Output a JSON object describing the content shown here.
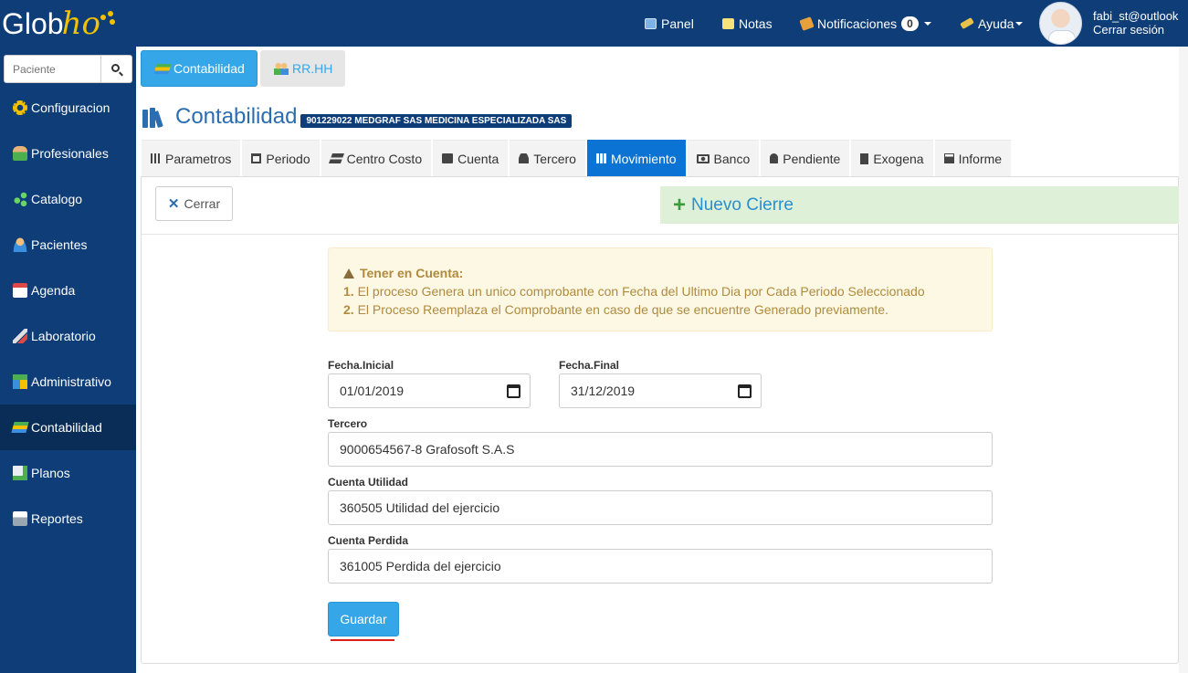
{
  "brand": {
    "logo_prefix": "Glob",
    "logo_script": "ho"
  },
  "topnav": {
    "panel": "Panel",
    "notas": "Notas",
    "notificaciones": "Notificaciones",
    "notif_count": "0",
    "ayuda": "Ayuda",
    "user_email": "fabi_st@outlook",
    "logout": "Cerrar sesión"
  },
  "sidebar": {
    "search_placeholder": "Paciente",
    "items": [
      {
        "label": "Configuracion",
        "icon": "gear-icon"
      },
      {
        "label": "Profesionales",
        "icon": "professionals-icon"
      },
      {
        "label": "Catalogo",
        "icon": "catalog-icon"
      },
      {
        "label": "Pacientes",
        "icon": "patient-icon"
      },
      {
        "label": "Agenda",
        "icon": "calendar-icon"
      },
      {
        "label": "Laboratorio",
        "icon": "laboratory-icon"
      },
      {
        "label": "Administrativo",
        "icon": "administrative-icon"
      },
      {
        "label": "Contabilidad",
        "icon": "accounting-icon",
        "active": true
      },
      {
        "label": "Planos",
        "icon": "plans-icon"
      },
      {
        "label": "Reportes",
        "icon": "printer-icon"
      }
    ]
  },
  "module_tabs": [
    {
      "label": "Contabilidad",
      "active": true
    },
    {
      "label": "RR.HH",
      "active": false
    }
  ],
  "page": {
    "title": "Contabilidad",
    "company_badge": "901229022 MEDGRAF SAS MEDICINA ESPECIALIZADA SAS"
  },
  "sub_tabs": [
    {
      "label": "Parametros",
      "icon": "sliders-icon"
    },
    {
      "label": "Periodo",
      "icon": "window-icon"
    },
    {
      "label": "Centro Costo",
      "icon": "cost-center-icon"
    },
    {
      "label": "Cuenta",
      "icon": "book-icon"
    },
    {
      "label": "Tercero",
      "icon": "user-icon"
    },
    {
      "label": "Movimiento",
      "icon": "grid-icon",
      "active": true
    },
    {
      "label": "Banco",
      "icon": "money-icon"
    },
    {
      "label": "Pendiente",
      "icon": "bell-icon"
    },
    {
      "label": "Exogena",
      "icon": "document-icon"
    },
    {
      "label": "Informe",
      "icon": "printer-icon"
    }
  ],
  "toolbar": {
    "close_label": "Cerrar",
    "new_closing": "Nuevo Cierre"
  },
  "alert": {
    "title": "Tener en Cuenta:",
    "line1_num": "1.",
    "line1": "El proceso Genera un unico comprobante con Fecha del Ultimo Dia por Cada Periodo Seleccionado",
    "line2_num": "2.",
    "line2": "El Proceso Reemplaza el Comprobante en caso de que se encuentre Generado previamente."
  },
  "form": {
    "fecha_inicial_label": "Fecha.Inicial",
    "fecha_inicial": "01/01/2019",
    "fecha_final_label": "Fecha.Final",
    "fecha_final": "31/12/2019",
    "tercero_label": "Tercero",
    "tercero": "9000654567-8 Grafosoft S.A.S",
    "cuenta_utilidad_label": "Cuenta Utilidad",
    "cuenta_utilidad": "360505 Utilidad del ejercicio",
    "cuenta_perdida_label": "Cuenta Perdida",
    "cuenta_perdida": "361005 Perdida del ejercicio",
    "save_label": "Guardar"
  },
  "colors": {
    "navy": "#0e3d78",
    "accent": "#35a7e8",
    "active_tab": "#0a73d4",
    "alert_bg": "#fcf8e3",
    "alert_text": "#b08a3e",
    "success_bg": "#dff0d8",
    "underline": "#e11b1b"
  }
}
